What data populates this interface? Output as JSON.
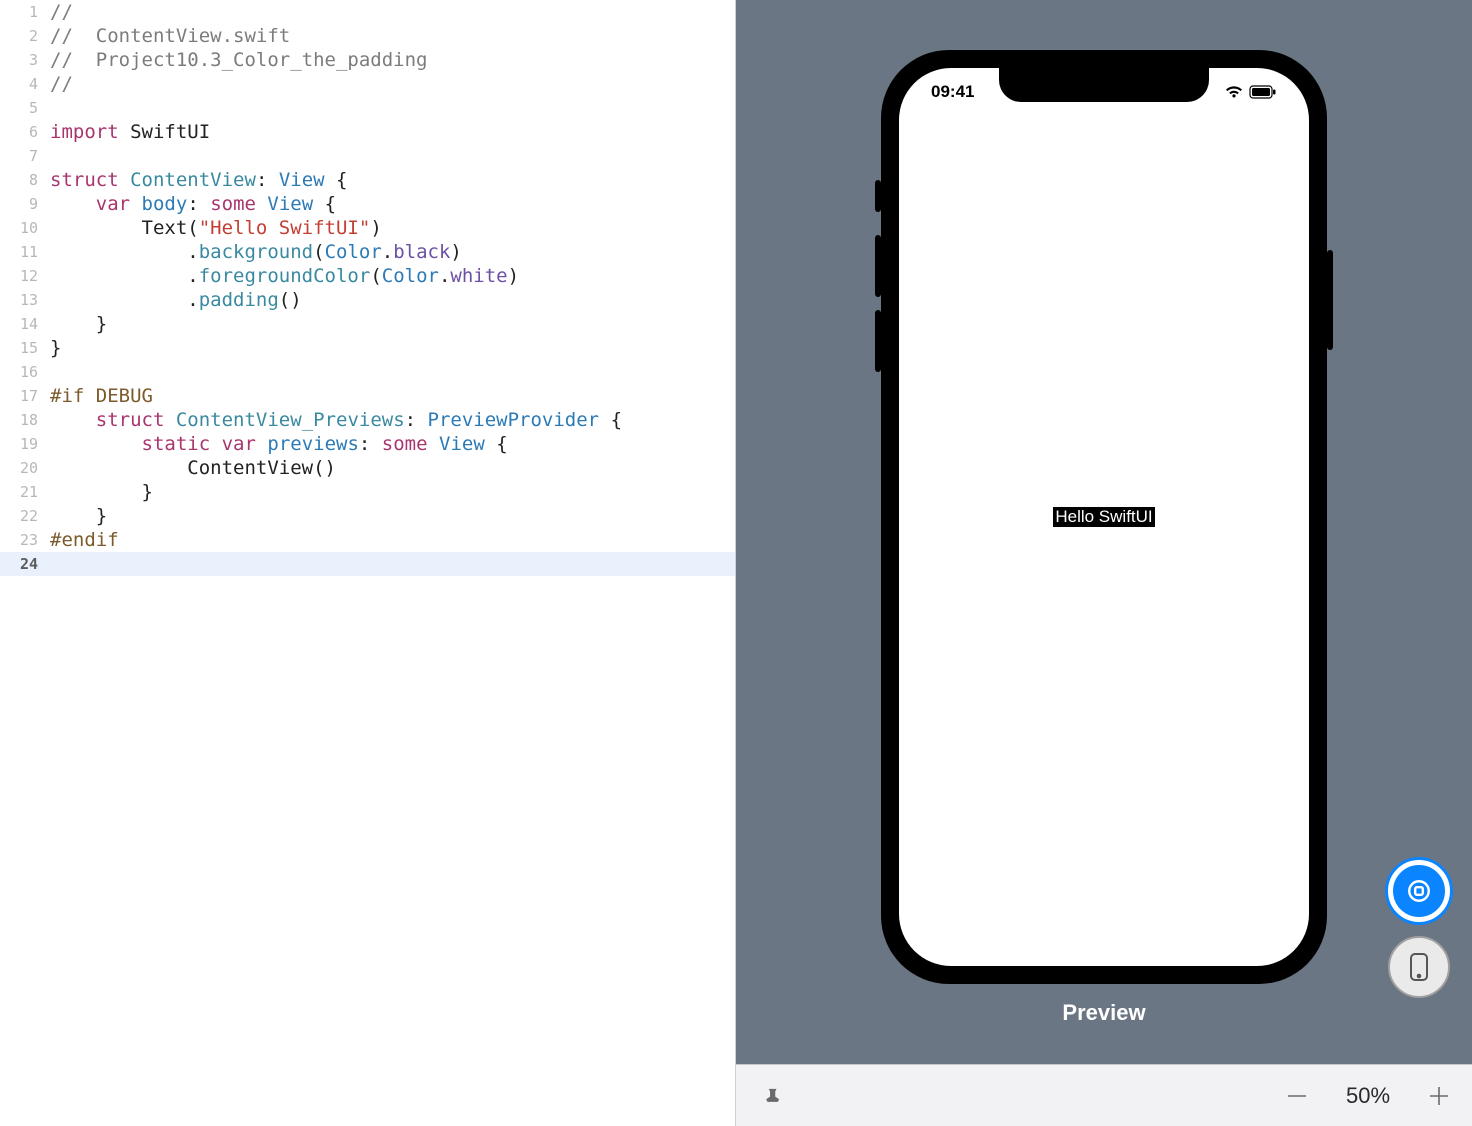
{
  "editor": {
    "lines": [
      {
        "n": 1,
        "tokens": [
          {
            "cls": "c-comment",
            "t": "//"
          }
        ]
      },
      {
        "n": 2,
        "tokens": [
          {
            "cls": "c-comment",
            "t": "//  ContentView.swift"
          }
        ]
      },
      {
        "n": 3,
        "tokens": [
          {
            "cls": "c-comment",
            "t": "//  Project10.3_Color_the_padding"
          }
        ]
      },
      {
        "n": 4,
        "tokens": [
          {
            "cls": "c-comment",
            "t": "//"
          }
        ]
      },
      {
        "n": 5,
        "tokens": []
      },
      {
        "n": 6,
        "tokens": [
          {
            "cls": "c-keyword",
            "t": "import"
          },
          {
            "cls": "c-plain",
            "t": " SwiftUI"
          }
        ]
      },
      {
        "n": 7,
        "tokens": []
      },
      {
        "n": 8,
        "tokens": [
          {
            "cls": "c-keyword",
            "t": "struct"
          },
          {
            "cls": "c-plain",
            "t": " "
          },
          {
            "cls": "c-typename",
            "t": "ContentView"
          },
          {
            "cls": "c-plain",
            "t": ": "
          },
          {
            "cls": "c-type",
            "t": "View"
          },
          {
            "cls": "c-plain",
            "t": " {"
          }
        ]
      },
      {
        "n": 9,
        "tokens": [
          {
            "cls": "c-plain",
            "t": "    "
          },
          {
            "cls": "c-keyword",
            "t": "var"
          },
          {
            "cls": "c-plain",
            "t": " "
          },
          {
            "cls": "c-prop",
            "t": "body"
          },
          {
            "cls": "c-plain",
            "t": ": "
          },
          {
            "cls": "c-keyword",
            "t": "some"
          },
          {
            "cls": "c-plain",
            "t": " "
          },
          {
            "cls": "c-type",
            "t": "View"
          },
          {
            "cls": "c-plain",
            "t": " {"
          }
        ]
      },
      {
        "n": 10,
        "tokens": [
          {
            "cls": "c-plain",
            "t": "        Text("
          },
          {
            "cls": "c-string",
            "t": "\"Hello SwiftUI\""
          },
          {
            "cls": "c-plain",
            "t": ")"
          }
        ]
      },
      {
        "n": 11,
        "tokens": [
          {
            "cls": "c-plain",
            "t": "            ."
          },
          {
            "cls": "c-funcname",
            "t": "background"
          },
          {
            "cls": "c-plain",
            "t": "("
          },
          {
            "cls": "c-type",
            "t": "Color"
          },
          {
            "cls": "c-plain",
            "t": "."
          },
          {
            "cls": "c-enum",
            "t": "black"
          },
          {
            "cls": "c-plain",
            "t": ")"
          }
        ]
      },
      {
        "n": 12,
        "tokens": [
          {
            "cls": "c-plain",
            "t": "            ."
          },
          {
            "cls": "c-funcname",
            "t": "foregroundColor"
          },
          {
            "cls": "c-plain",
            "t": "("
          },
          {
            "cls": "c-type",
            "t": "Color"
          },
          {
            "cls": "c-plain",
            "t": "."
          },
          {
            "cls": "c-enum",
            "t": "white"
          },
          {
            "cls": "c-plain",
            "t": ")"
          }
        ]
      },
      {
        "n": 13,
        "tokens": [
          {
            "cls": "c-plain",
            "t": "            ."
          },
          {
            "cls": "c-funcname",
            "t": "padding"
          },
          {
            "cls": "c-plain",
            "t": "()"
          }
        ]
      },
      {
        "n": 14,
        "tokens": [
          {
            "cls": "c-plain",
            "t": "    }"
          }
        ]
      },
      {
        "n": 15,
        "tokens": [
          {
            "cls": "c-plain",
            "t": "}"
          }
        ]
      },
      {
        "n": 16,
        "tokens": []
      },
      {
        "n": 17,
        "tokens": [
          {
            "cls": "c-pp",
            "t": "#if DEBUG"
          }
        ]
      },
      {
        "n": 18,
        "tokens": [
          {
            "cls": "c-plain",
            "t": "    "
          },
          {
            "cls": "c-keyword",
            "t": "struct"
          },
          {
            "cls": "c-plain",
            "t": " "
          },
          {
            "cls": "c-typename",
            "t": "ContentView_Previews"
          },
          {
            "cls": "c-plain",
            "t": ": "
          },
          {
            "cls": "c-type",
            "t": "PreviewProvider"
          },
          {
            "cls": "c-plain",
            "t": " {"
          }
        ]
      },
      {
        "n": 19,
        "tokens": [
          {
            "cls": "c-plain",
            "t": "        "
          },
          {
            "cls": "c-keyword",
            "t": "static"
          },
          {
            "cls": "c-plain",
            "t": " "
          },
          {
            "cls": "c-keyword",
            "t": "var"
          },
          {
            "cls": "c-plain",
            "t": " "
          },
          {
            "cls": "c-prop",
            "t": "previews"
          },
          {
            "cls": "c-plain",
            "t": ": "
          },
          {
            "cls": "c-keyword",
            "t": "some"
          },
          {
            "cls": "c-plain",
            "t": " "
          },
          {
            "cls": "c-type",
            "t": "View"
          },
          {
            "cls": "c-plain",
            "t": " {"
          }
        ]
      },
      {
        "n": 20,
        "tokens": [
          {
            "cls": "c-plain",
            "t": "            ContentView()"
          }
        ]
      },
      {
        "n": 21,
        "tokens": [
          {
            "cls": "c-plain",
            "t": "        }"
          }
        ]
      },
      {
        "n": 22,
        "tokens": [
          {
            "cls": "c-plain",
            "t": "    }"
          }
        ]
      },
      {
        "n": 23,
        "tokens": [
          {
            "cls": "c-pp",
            "t": "#endif"
          }
        ]
      },
      {
        "n": 24,
        "tokens": [],
        "current": true
      }
    ]
  },
  "preview": {
    "title": "Preview",
    "status_time": "09:41",
    "hello_text": "Hello SwiftUI"
  },
  "toolbar": {
    "zoom_level": "50%"
  }
}
